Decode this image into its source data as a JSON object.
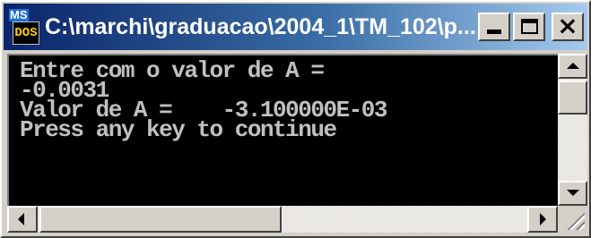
{
  "window": {
    "title": "C:\\marchi\\graduacao\\2004_1\\TM_102\\p...",
    "icon": "msdos-icon",
    "icon_text_ms": "MS",
    "icon_text_dos": "DOS"
  },
  "console": {
    "lines": [
      "Entre com o valor de A =",
      "-0.0031",
      "Valor de A =    -3.100000E-03",
      "Press any key to continue"
    ]
  },
  "controls": {
    "minimize_icon": "minimize-icon",
    "maximize_icon": "maximize-icon",
    "close_icon": "close-icon",
    "close_glyph": "×"
  },
  "colors": {
    "title_bar_start": "#0a246a",
    "title_bar_end": "#a6caf0",
    "console_background": "#000000",
    "console_text": "#c0c0c0"
  }
}
